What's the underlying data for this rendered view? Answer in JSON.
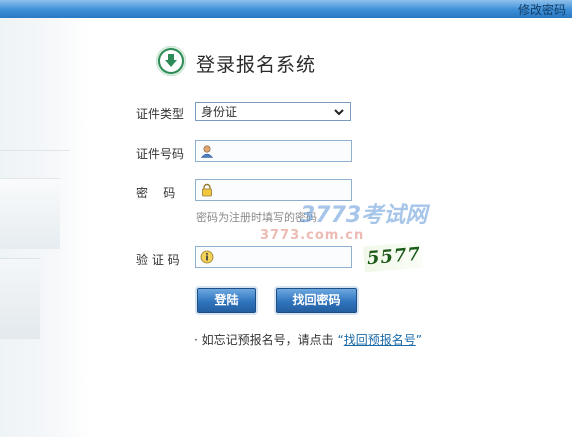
{
  "topbar": {
    "change_password": "修改密码"
  },
  "title": "登录报名系统",
  "form": {
    "id_type_label": "证件类型",
    "id_type_value": "身份证",
    "id_number_label": "证件号码",
    "password_label": "密    码",
    "password_hint": "密码为注册时填写的密码",
    "captcha_label": "验 证 码",
    "captcha_text": "5577",
    "login_button": "登陆",
    "recover_button": "找回密码"
  },
  "forgot": {
    "bullet": "·",
    "prefix": "如忘记预报名号，请点击",
    "quote_open": "“",
    "link": "找回预报名号",
    "quote_close": "”"
  },
  "watermark": {
    "line1": "3773考试网",
    "line2": "3773.com.cn"
  },
  "colors": {
    "topbar": "#3d8fd6",
    "button": "#2f74bd",
    "icon_green": "#2e8b57",
    "link": "#1a6aa8"
  }
}
